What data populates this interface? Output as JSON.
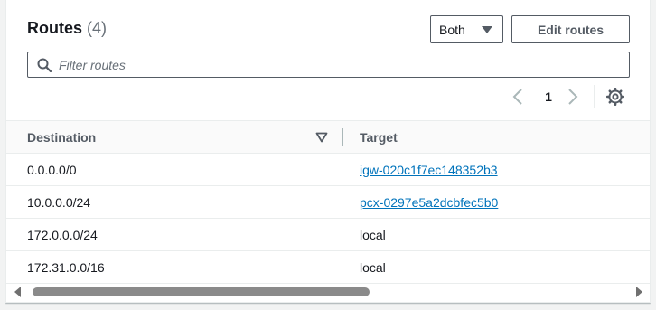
{
  "header": {
    "title": "Routes",
    "count": "(4)"
  },
  "toolbar": {
    "filter_select_value": "Both",
    "edit_label": "Edit routes"
  },
  "search": {
    "placeholder": "Filter routes"
  },
  "pagination": {
    "current_page": "1"
  },
  "icons": {
    "search": "search-icon",
    "caret": "caret-down-icon",
    "prev": "chevron-left-icon",
    "next": "chevron-right-icon",
    "settings": "gear-icon",
    "sort": "sort-descending-icon"
  },
  "table": {
    "columns": [
      "Destination",
      "Target"
    ],
    "rows": [
      {
        "destination": "0.0.0.0/0",
        "target": "igw-020c1f7ec148352b3",
        "is_link": true
      },
      {
        "destination": "10.0.0.0/24",
        "target": "pcx-0297e5a2dcbfec5b0",
        "is_link": true
      },
      {
        "destination": "172.0.0.0/24",
        "target": "local",
        "is_link": false
      },
      {
        "destination": "172.31.0.0/16",
        "target": "local",
        "is_link": false
      }
    ]
  },
  "colors": {
    "link": "#0073bb",
    "border": "#545b64",
    "text": "#16191f",
    "muted": "#687078"
  }
}
